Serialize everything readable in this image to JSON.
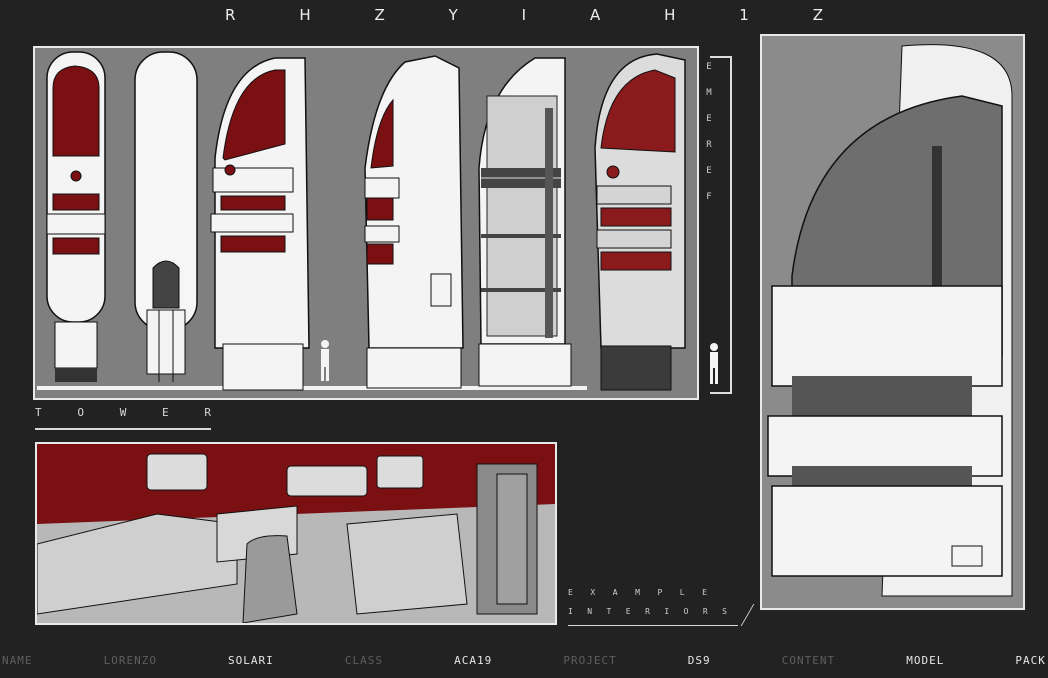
{
  "title": {
    "letters": [
      "R",
      "H",
      "Z",
      "Y",
      "I",
      "A",
      "H",
      "1",
      "Z"
    ]
  },
  "tower_label": {
    "letters": [
      "T",
      "O",
      "W",
      "E",
      "R"
    ]
  },
  "vertical_label": {
    "letters": [
      "E",
      "M",
      "E",
      "R",
      "E",
      "F"
    ]
  },
  "interior_label": {
    "line1": [
      "E",
      "X",
      "A",
      "M",
      "P",
      "L",
      "E"
    ],
    "line2": [
      "I",
      "N",
      "T",
      "E",
      "R",
      "I",
      "O",
      "R",
      "S"
    ]
  },
  "footer": [
    {
      "text": "NAME",
      "tone": "dim"
    },
    {
      "text": "LORENZO",
      "tone": "dim"
    },
    {
      "text": "SOLARI",
      "tone": "bright"
    },
    {
      "text": "CLASS",
      "tone": "dim"
    },
    {
      "text": "ACA19",
      "tone": "bright"
    },
    {
      "text": "PROJECT",
      "tone": "dim"
    },
    {
      "text": "DS9",
      "tone": "bright"
    },
    {
      "text": "CONTENT",
      "tone": "dim"
    },
    {
      "text": "MODEL",
      "tone": "bright"
    },
    {
      "text": "PACK",
      "tone": "bright"
    }
  ],
  "colors": {
    "background": "#222223",
    "panel_border": "#e9e9e9",
    "accent_red": "#7a1012",
    "hull_white": "#f4f4f4",
    "glass_grey": "#5e5e5e"
  }
}
